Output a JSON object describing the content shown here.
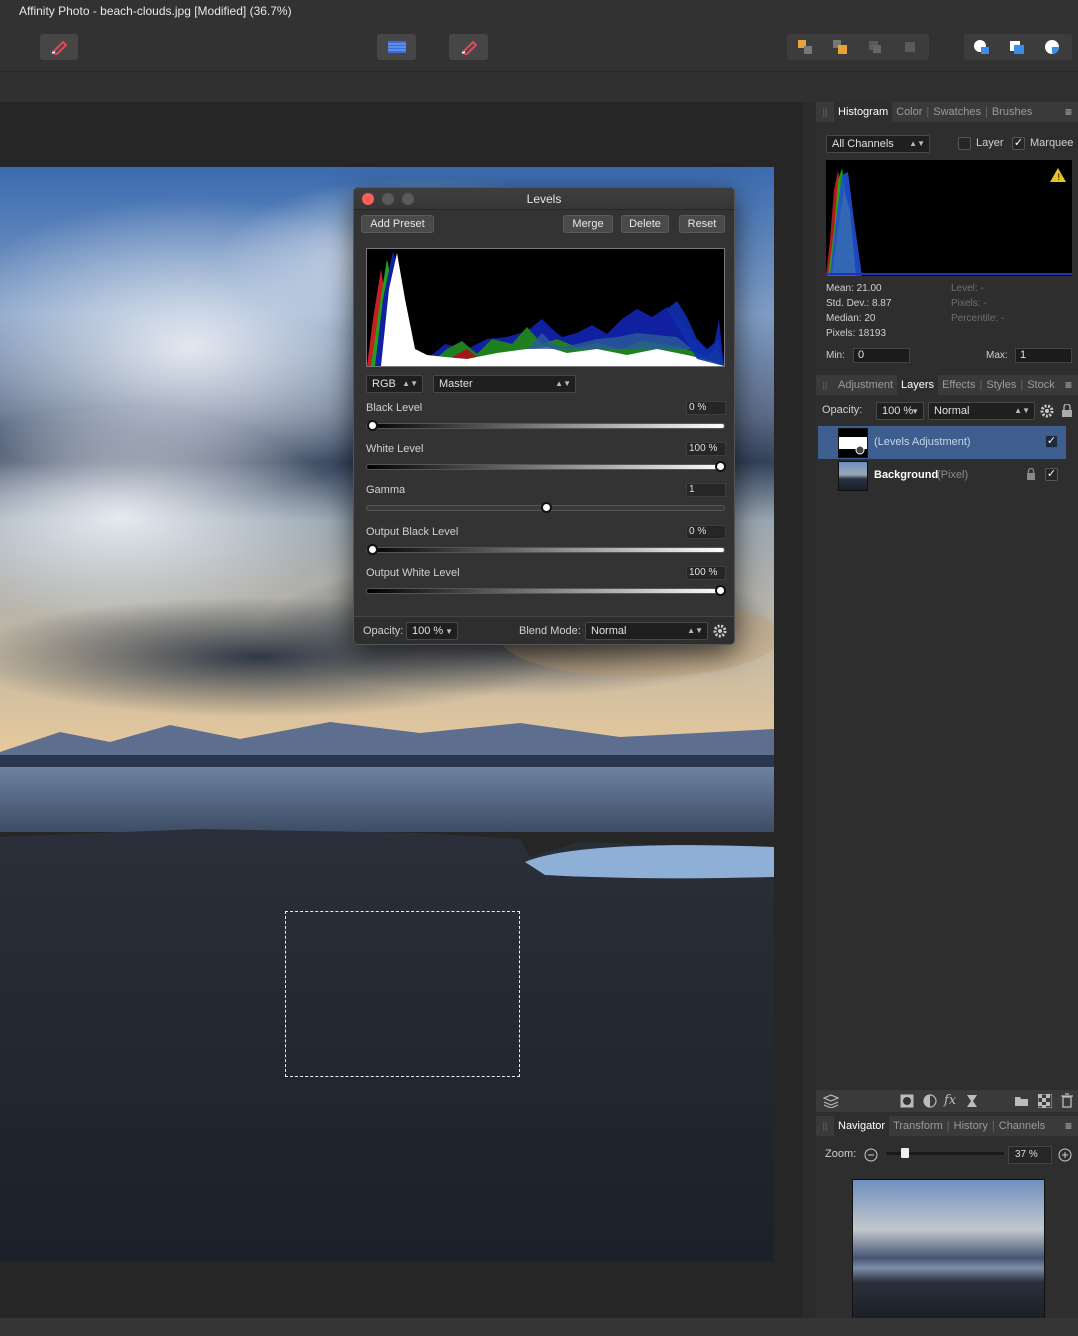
{
  "window": {
    "title": "Affinity Photo - beach-clouds.jpg [Modified] (36.7%)"
  },
  "toolbar": {
    "left_tool": "selection-brush-icon",
    "center_tools": [
      "grid-icon",
      "refine-brush-icon"
    ],
    "arrange_tools": [
      "bring-forward-icon",
      "send-backward-icon",
      "move-front-icon",
      "move-back-icon"
    ],
    "boolean_tools": [
      "add-icon",
      "subtract-icon",
      "intersect-icon"
    ]
  },
  "histogram_panel": {
    "tabs": [
      "Histogram",
      "Color",
      "Swatches",
      "Brushes"
    ],
    "active_tab": "Histogram",
    "channels": "All Channels",
    "layer_label": "Layer",
    "layer_checked": false,
    "marquee_label": "Marquee",
    "marquee_checked": true,
    "warning_icon": "warning-icon",
    "stats": {
      "mean": "Mean: 21.00",
      "std_dev": "Std. Dev.: 8.87",
      "median": "Median: 20",
      "pixels": "Pixels: 18193",
      "level": "Level: -",
      "pixels_right": "Pixels: -",
      "percentile": "Percentile: -"
    },
    "min_label": "Min:",
    "min_value": "0",
    "max_label": "Max:",
    "max_value": "1"
  },
  "layers_panel": {
    "tabs": [
      "Adjustment",
      "Layers",
      "Effects",
      "Styles",
      "Stock"
    ],
    "active_tab": "Layers",
    "opacity_label": "Opacity:",
    "opacity_value": "100 %",
    "blend_mode": "Normal",
    "layers": [
      {
        "name": "(Levels Adjustment)",
        "type": "",
        "selected": true,
        "visible": true,
        "locked": false
      },
      {
        "name": "Background",
        "type": "(Pixel)",
        "selected": false,
        "visible": true,
        "locked": true
      }
    ],
    "bottom_icons": [
      "layers-stack-icon",
      "mask-icon",
      "adjustment-icon",
      "fx-icon",
      "live-filter-icon",
      "folder-icon",
      "checker-icon",
      "trash-icon"
    ]
  },
  "navigator_panel": {
    "tabs": [
      "Navigator",
      "Transform",
      "History",
      "Channels"
    ],
    "active_tab": "Navigator",
    "zoom_label": "Zoom:",
    "zoom_value": "37 %",
    "zoom_level": 0.37
  },
  "levels_dialog": {
    "title": "Levels",
    "buttons": {
      "add_preset": "Add Preset",
      "merge": "Merge",
      "delete": "Delete",
      "reset": "Reset"
    },
    "channel_mode": "RGB",
    "channel": "Master",
    "sliders": [
      {
        "label": "Black Level",
        "value": "0 %",
        "level": 0.0,
        "gradient": "normal"
      },
      {
        "label": "White Level",
        "value": "100 %",
        "level": 1.0,
        "gradient": "normal"
      },
      {
        "label": "Gamma",
        "value": "1",
        "level": 0.5,
        "gradient": "flat"
      },
      {
        "label": "Output Black Level",
        "value": "0 %",
        "level": 0.0,
        "gradient": "normal"
      },
      {
        "label": "Output White Level",
        "value": "100 %",
        "level": 1.0,
        "gradient": "normal"
      }
    ],
    "opacity_label": "Opacity:",
    "opacity_value": "100 %",
    "blend_label": "Blend Mode:",
    "blend_value": "Normal"
  },
  "colors": {
    "accent": "#3d5e8e",
    "traffic_close": "#fc5f57",
    "traffic_inactive": "#5a5a5a"
  }
}
